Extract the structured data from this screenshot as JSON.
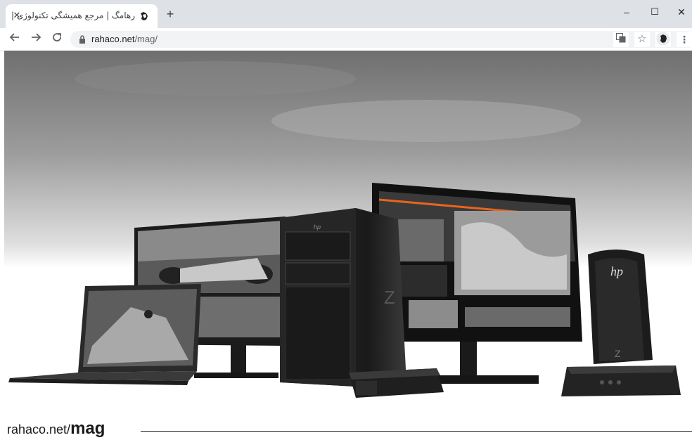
{
  "browser": {
    "tab": {
      "title": "رهامگ | مرجع همیشگی تکنولوژی |",
      "favicon": "rahaco-logo-icon",
      "close_icon": "close-icon"
    },
    "new_tab_icon": "plus-icon",
    "window_controls": {
      "minimize": "–",
      "maximize": "☐",
      "close": "✕"
    },
    "toolbar": {
      "back_icon": "arrow-left-icon",
      "forward_icon": "arrow-right-icon",
      "reload_icon": "reload-icon",
      "lock_icon": "lock-icon",
      "url_host": "rahaco.net",
      "url_path": "/mag/",
      "translate_icon": "translate-icon",
      "bookmark_icon": "star-icon",
      "profile_icon": "profile-avatar-icon",
      "menu_icon": "kebab-menu-icon"
    }
  },
  "hero": {
    "image": "HP Z workstation lineup: laptop, monitors, tower, mini PC and VR backpack PC",
    "brand_mark": "hp",
    "tower_badge": "Z",
    "vr_badge": "Z"
  },
  "caption": {
    "site": "rahaco.net/",
    "section": "mag"
  },
  "colors": {
    "accent": "#e8641e",
    "titlebar": "#dee1e6"
  }
}
